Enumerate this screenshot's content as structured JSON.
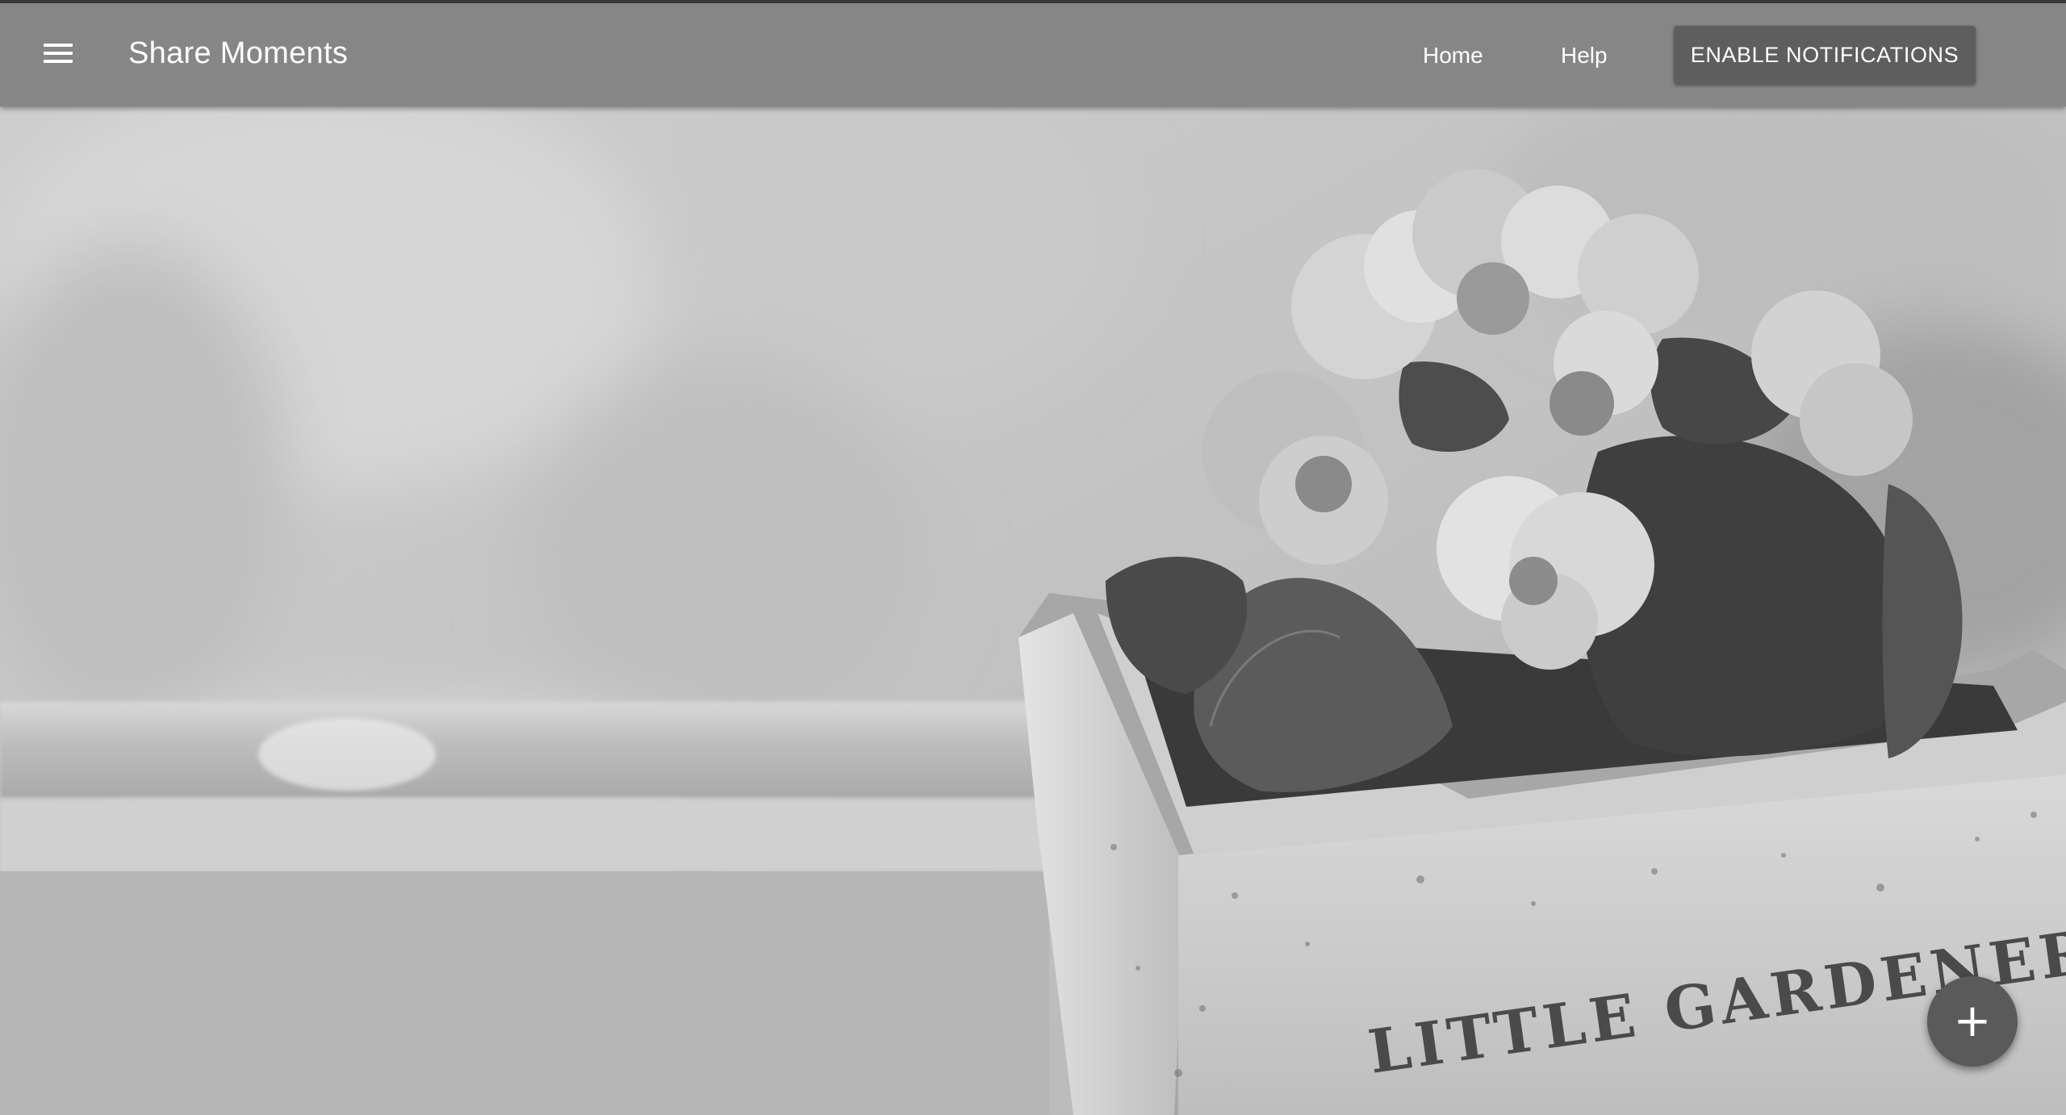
{
  "app_bar": {
    "title": "Share Moments",
    "nav": {
      "home_label": "Home",
      "help_label": "Help"
    },
    "enable_notifications_label": "ENABLE NOTIFICATIONS"
  },
  "hero": {
    "pot_text": "LITTLE GARDENER"
  },
  "fab": {
    "icon": "plus-icon",
    "glyph": "+"
  },
  "colors": {
    "app_bar": "#868686",
    "button": "#5e5e5e",
    "fab": "#5a5a5a"
  }
}
